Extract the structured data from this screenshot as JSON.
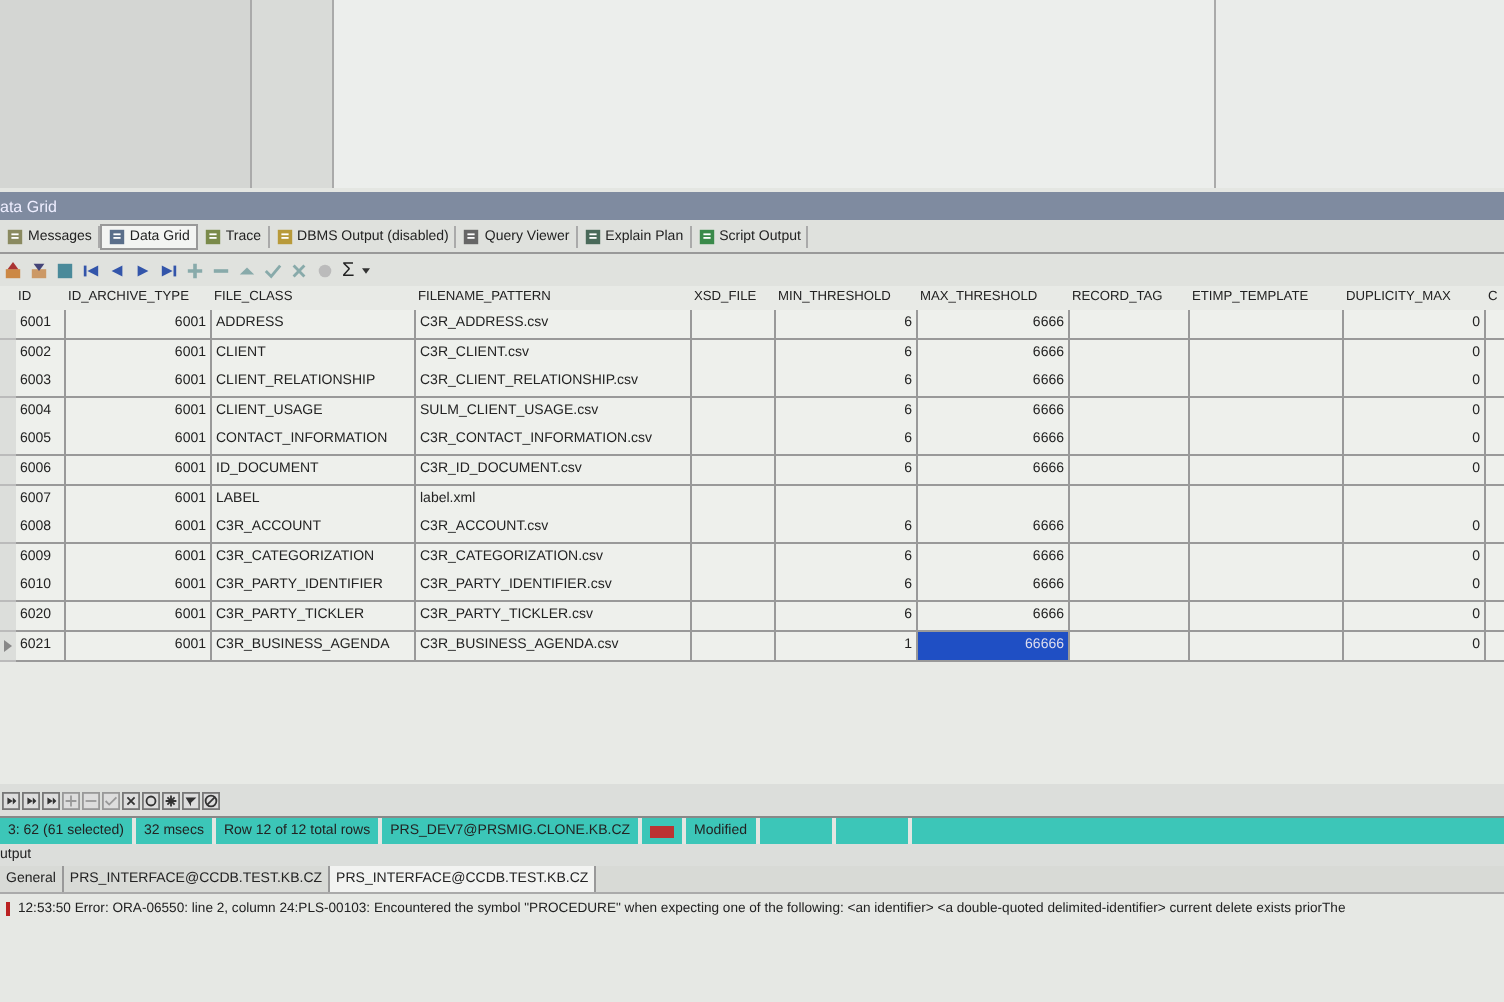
{
  "panel_title": "ata Grid",
  "tabs": [
    {
      "label": "Messages",
      "selected": false
    },
    {
      "label": "Data Grid",
      "selected": true
    },
    {
      "label": "Trace",
      "selected": false
    },
    {
      "label": "DBMS Output (disabled)",
      "selected": false
    },
    {
      "label": "Query Viewer",
      "selected": false
    },
    {
      "label": "Explain Plan",
      "selected": false
    },
    {
      "label": "Script Output",
      "selected": false
    }
  ],
  "toolbar": {
    "sum_symbol": "Σ"
  },
  "table": {
    "columns": [
      "ID",
      "ID_ARCHIVE_TYPE",
      "FILE_CLASS",
      "FILENAME_PATTERN",
      "XSD_FILE",
      "MIN_THRESHOLD",
      "MAX_THRESHOLD",
      "RECORD_TAG",
      "ETIMP_TEMPLATE",
      "DUPLICITY_MAX",
      "C"
    ],
    "rows": [
      {
        "id": "6001",
        "id_archive_type": "6001",
        "file_class": "ADDRESS",
        "filename_pattern": "C3R_ADDRESS.csv",
        "min_threshold": "6",
        "max_threshold": "6666",
        "duplicity_max": "0",
        "selected": false
      },
      {
        "id": "6002",
        "id_archive_type": "6001",
        "file_class": "CLIENT",
        "filename_pattern": "C3R_CLIENT.csv",
        "min_threshold": "6",
        "max_threshold": "6666",
        "duplicity_max": "0",
        "selected": false
      },
      {
        "id": "6003",
        "id_archive_type": "6001",
        "file_class": "CLIENT_RELATIONSHIP",
        "filename_pattern": "C3R_CLIENT_RELATIONSHIP.csv",
        "min_threshold": "6",
        "max_threshold": "6666",
        "duplicity_max": "0",
        "selected": false
      },
      {
        "id": "6004",
        "id_archive_type": "6001",
        "file_class": "CLIENT_USAGE",
        "filename_pattern": "SULM_CLIENT_USAGE.csv",
        "min_threshold": "6",
        "max_threshold": "6666",
        "duplicity_max": "0",
        "selected": false
      },
      {
        "id": "6005",
        "id_archive_type": "6001",
        "file_class": "CONTACT_INFORMATION",
        "filename_pattern": "C3R_CONTACT_INFORMATION.csv",
        "min_threshold": "6",
        "max_threshold": "6666",
        "duplicity_max": "0",
        "selected": false
      },
      {
        "id": "6006",
        "id_archive_type": "6001",
        "file_class": "ID_DOCUMENT",
        "filename_pattern": "C3R_ID_DOCUMENT.csv",
        "min_threshold": "6",
        "max_threshold": "6666",
        "duplicity_max": "0",
        "selected": false
      },
      {
        "id": "6007",
        "id_archive_type": "6001",
        "file_class": "LABEL",
        "filename_pattern": "label.xml",
        "selected": false
      },
      {
        "id": "6008",
        "id_archive_type": "6001",
        "file_class": "C3R_ACCOUNT",
        "filename_pattern": "C3R_ACCOUNT.csv",
        "min_threshold": "6",
        "max_threshold": "6666",
        "duplicity_max": "0",
        "selected": false
      },
      {
        "id": "6009",
        "id_archive_type": "6001",
        "file_class": "C3R_CATEGORIZATION",
        "filename_pattern": "C3R_CATEGORIZATION.csv",
        "min_threshold": "6",
        "max_threshold": "6666",
        "duplicity_max": "0",
        "selected": false
      },
      {
        "id": "6010",
        "id_archive_type": "6001",
        "file_class": "C3R_PARTY_IDENTIFIER",
        "filename_pattern": "C3R_PARTY_IDENTIFIER.csv",
        "min_threshold": "6",
        "max_threshold": "6666",
        "duplicity_max": "0",
        "selected": false
      },
      {
        "id": "6020",
        "id_archive_type": "6001",
        "file_class": "C3R_PARTY_TICKLER",
        "filename_pattern": "C3R_PARTY_TICKLER.csv",
        "min_threshold": "6",
        "max_threshold": "6666",
        "duplicity_max": "0",
        "selected": false
      },
      {
        "id": "6021",
        "id_archive_type": "6001",
        "file_class": "C3R_BUSINESS_AGENDA",
        "filename_pattern": "C3R_BUSINESS_AGENDA.csv",
        "min_threshold": "1",
        "max_threshold": "66666",
        "duplicity_max": "0",
        "selected": true
      }
    ]
  },
  "status_bar": [
    {
      "kind": "text",
      "text": "3: 62 (61 selected)"
    },
    {
      "kind": "text",
      "text": "32 msecs"
    },
    {
      "kind": "text",
      "text": "Row 12 of 12 total rows"
    },
    {
      "kind": "text",
      "text": "PRS_DEV7@PRSMIG.CLONE.KB.CZ"
    },
    {
      "kind": "icon"
    },
    {
      "kind": "text",
      "text": "Modified"
    },
    {
      "kind": "empty"
    },
    {
      "kind": "empty"
    },
    {
      "kind": "fill"
    }
  ],
  "output": {
    "title": "utput",
    "tabs": [
      {
        "label": "General",
        "selected": false
      },
      {
        "label": "PRS_INTERFACE@CCDB.TEST.KB.CZ",
        "selected": false
      },
      {
        "label": "PRS_INTERFACE@CCDB.TEST.KB.CZ",
        "selected": true
      }
    ],
    "messages": [
      {
        "kind": "error",
        "text": "12:53:50 Error: ORA-06550: line 2, column 24:PLS-00103: Encountered the symbol \"PROCEDURE\" when expecting one of the following:    <an identifier> <a double-quoted delimited-identifier>   current delete exists priorThe"
      }
    ]
  }
}
